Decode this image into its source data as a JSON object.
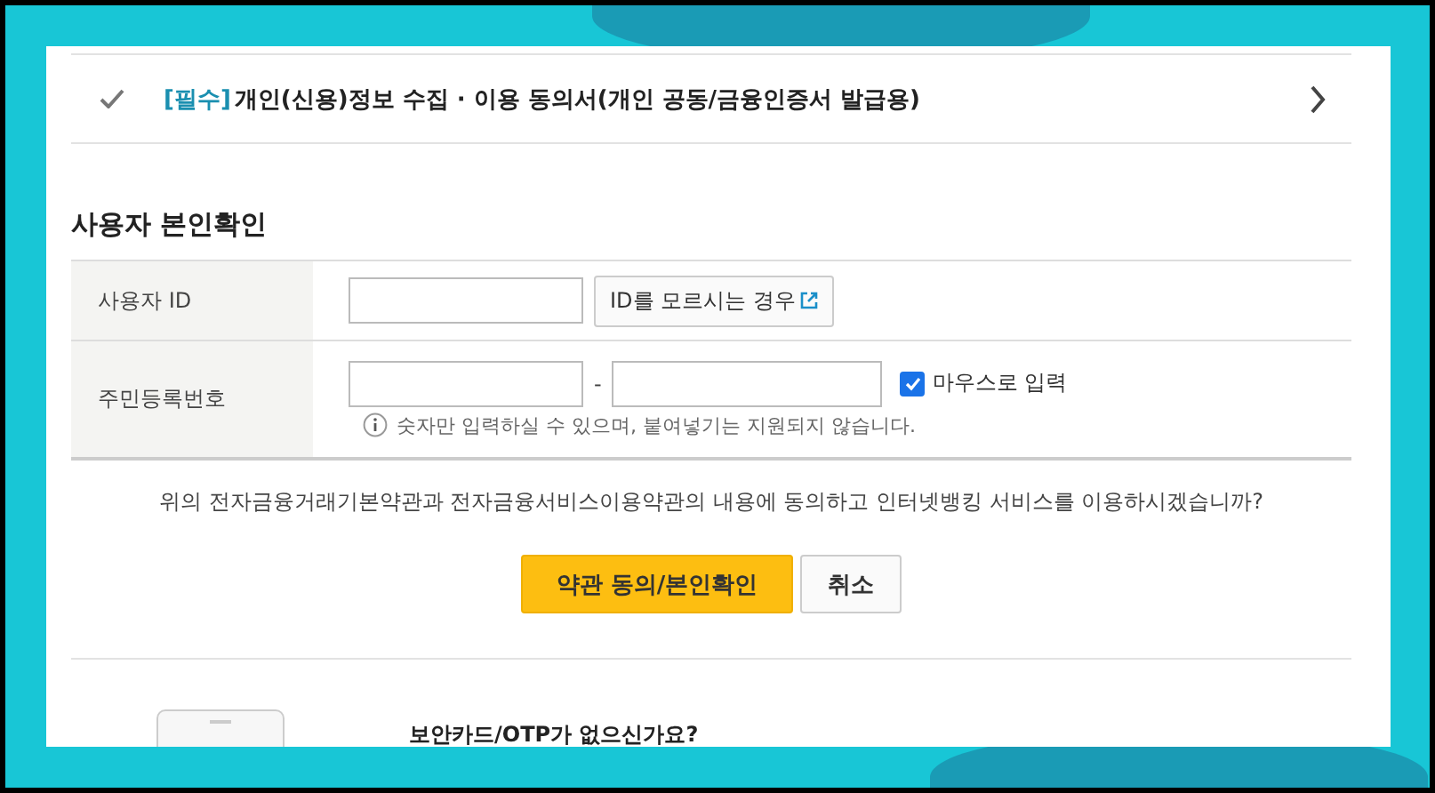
{
  "agreement": {
    "checked": true,
    "required_tag": "[필수]",
    "title": "개인(신용)정보 수집 · 이용 동의서(개인 공동/금융인증서 발급용)"
  },
  "section_title": "사용자 본인확인",
  "user_id": {
    "label": "사용자 ID",
    "find_id_button": "ID를 모르시는 경우"
  },
  "resident_number": {
    "label": "주민등록번호",
    "separator": "-",
    "mouse_input": {
      "label": "마우스로 입력",
      "checked": true
    },
    "hint": "숫자만 입력하실 수 있으며, 붙여넣기는 지원되지 않습니다."
  },
  "confirm_message": "위의 전자금융거래기본약관과 전자금융서비스이용약관의 내용에 동의하고 인터넷뱅킹 서비스를 이용하시겠습니까?",
  "buttons": [
    {
      "label": "약관 동의/본인확인",
      "kind": "primary"
    },
    {
      "label": "취소",
      "kind": "secondary"
    }
  ],
  "security_card": {
    "title": "보안카드/OTP가 없으신가요?"
  }
}
